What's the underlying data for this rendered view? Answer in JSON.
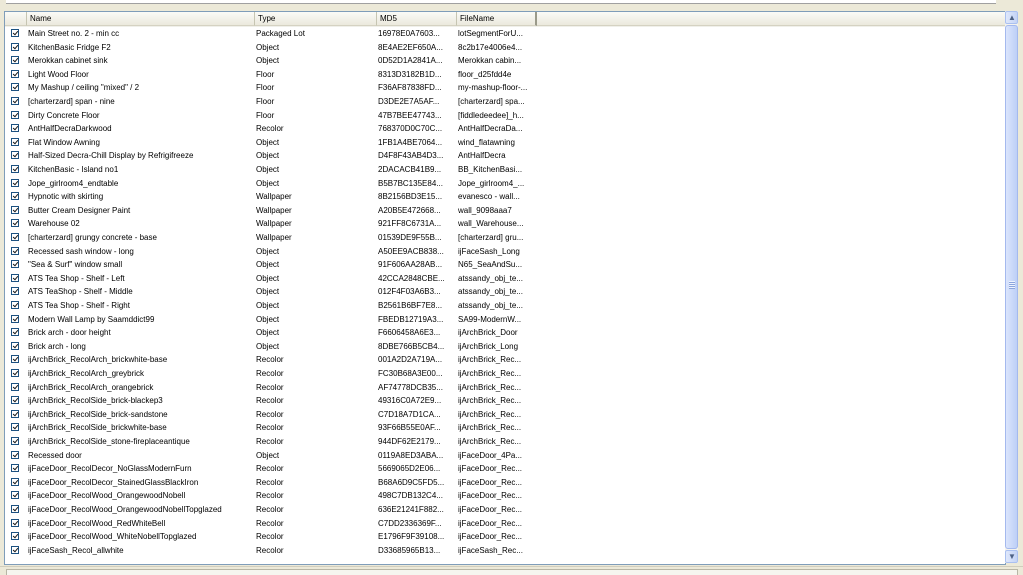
{
  "columns": {
    "name": "Name",
    "type": "Type",
    "md5": "MD5",
    "filename": "FileName"
  },
  "rows": [
    {
      "name": "Main Street no. 2 - min cc",
      "type": "Packaged Lot",
      "md5": "16978E0A7603...",
      "file": "lotSegmentForU..."
    },
    {
      "name": "KitchenBasic Fridge F2",
      "type": "Object",
      "md5": "8E4AE2EF650A...",
      "file": "8c2b17e4006e4..."
    },
    {
      "name": "Merokkan cabinet sink",
      "type": "Object",
      "md5": "0D52D1A2841A...",
      "file": "Merokkan cabin..."
    },
    {
      "name": "Light Wood Floor",
      "type": "Floor",
      "md5": "8313D3182B1D...",
      "file": "floor_d25fdd4e"
    },
    {
      "name": "My Mashup / ceiling \"mixed\" / 2",
      "type": "Floor",
      "md5": "F36AF87838FD...",
      "file": "my-mashup-floor-..."
    },
    {
      "name": "[charterzard] span - nine",
      "type": "Floor",
      "md5": "D3DE2E7A5AF...",
      "file": "[charterzard] spa..."
    },
    {
      "name": "Dirty Concrete Floor",
      "type": "Floor",
      "md5": "47B7BEE47743...",
      "file": "[fiddledeedee]_h..."
    },
    {
      "name": "AntHalfDecraDarkwood",
      "type": "Recolor",
      "md5": "768370D0C70C...",
      "file": "AntHalfDecraDa..."
    },
    {
      "name": "Flat Window Awning",
      "type": "Object",
      "md5": "1FB1A4BE7064...",
      "file": "wind_flatawning"
    },
    {
      "name": "Half-Sized Decra-Chill Display by Refrigifreeze",
      "type": "Object",
      "md5": "D4F8F43AB4D3...",
      "file": "AntHalfDecra"
    },
    {
      "name": "KitchenBasic - Island no1",
      "type": "Object",
      "md5": "2DACACB41B9...",
      "file": "BB_KitchenBasi..."
    },
    {
      "name": "Jope_girlroom4_endtable",
      "type": "Object",
      "md5": "B5B7BC135E84...",
      "file": "Jope_girlroom4_..."
    },
    {
      "name": "Hypnotic with skirting",
      "type": "Wallpaper",
      "md5": "8B2156BD3E15...",
      "file": "evanesco - wall..."
    },
    {
      "name": "Butter Cream Designer Paint",
      "type": "Wallpaper",
      "md5": "A20B5E472668...",
      "file": "wall_9098aaa7"
    },
    {
      "name": "Warehouse 02",
      "type": "Wallpaper",
      "md5": "921FF8C6731A...",
      "file": "wall_Warehouse..."
    },
    {
      "name": "[charterzard] grungy concrete - base",
      "type": "Wallpaper",
      "md5": "01539DE9F55B...",
      "file": "[charterzard] gru..."
    },
    {
      "name": "Recessed sash window - long",
      "type": "Object",
      "md5": "A50EE9ACB838...",
      "file": "ijFaceSash_Long"
    },
    {
      "name": "\"Sea & Surf\" window small",
      "type": "Object",
      "md5": "91F606AA28AB...",
      "file": "N65_SeaAndSu..."
    },
    {
      "name": "ATS Tea Shop - Shelf - Left",
      "type": "Object",
      "md5": "42CCA2848CBE...",
      "file": "atssandy_obj_te..."
    },
    {
      "name": "ATS TeaShop - Shelf - Middle",
      "type": "Object",
      "md5": "012F4F03A6B3...",
      "file": "atssandy_obj_te..."
    },
    {
      "name": "ATS Tea Shop - Shelf - Right",
      "type": "Object",
      "md5": "B2561B6BF7E8...",
      "file": "atssandy_obj_te..."
    },
    {
      "name": "Modern Wall Lamp by Saamddict99",
      "type": "Object",
      "md5": "FBEDB12719A3...",
      "file": "SA99-ModernW..."
    },
    {
      "name": "Brick arch - door height",
      "type": "Object",
      "md5": "F6606458A6E3...",
      "file": "ijArchBrick_Door"
    },
    {
      "name": "Brick arch - long",
      "type": "Object",
      "md5": "8DBE766B5CB4...",
      "file": "ijArchBrick_Long"
    },
    {
      "name": "ijArchBrick_RecolArch_brickwhite-base",
      "type": "Recolor",
      "md5": "001A2D2A719A...",
      "file": "ijArchBrick_Rec..."
    },
    {
      "name": "ijArchBrick_RecolArch_greybrick",
      "type": "Recolor",
      "md5": "FC30B68A3E00...",
      "file": "ijArchBrick_Rec..."
    },
    {
      "name": "ijArchBrick_RecolArch_orangebrick",
      "type": "Recolor",
      "md5": "AF74778DCB35...",
      "file": "ijArchBrick_Rec..."
    },
    {
      "name": "ijArchBrick_RecolSide_brick-blackep3",
      "type": "Recolor",
      "md5": "49316C0A72E9...",
      "file": "ijArchBrick_Rec..."
    },
    {
      "name": "ijArchBrick_RecolSide_brick-sandstone",
      "type": "Recolor",
      "md5": "C7D18A7D1CA...",
      "file": "ijArchBrick_Rec..."
    },
    {
      "name": "ijArchBrick_RecolSide_brickwhite-base",
      "type": "Recolor",
      "md5": "93F66B55E0AF...",
      "file": "ijArchBrick_Rec..."
    },
    {
      "name": "ijArchBrick_RecolSide_stone-fireplaceantique",
      "type": "Recolor",
      "md5": "944DF62E2179...",
      "file": "ijArchBrick_Rec..."
    },
    {
      "name": "Recessed door",
      "type": "Object",
      "md5": "0119A8ED3ABA...",
      "file": "ijFaceDoor_4Pa..."
    },
    {
      "name": "ijFaceDoor_RecolDecor_NoGlassModernFurn",
      "type": "Recolor",
      "md5": "5669065D2E06...",
      "file": "ijFaceDoor_Rec..."
    },
    {
      "name": "ijFaceDoor_RecolDecor_StainedGlassBlackIron",
      "type": "Recolor",
      "md5": "B68A6D9C5FD5...",
      "file": "ijFaceDoor_Rec..."
    },
    {
      "name": "ijFaceDoor_RecolWood_OrangewoodNobell",
      "type": "Recolor",
      "md5": "498C7DB132C4...",
      "file": "ijFaceDoor_Rec..."
    },
    {
      "name": "ijFaceDoor_RecolWood_OrangewoodNobellTopglazed",
      "type": "Recolor",
      "md5": "636E21241F882...",
      "file": "ijFaceDoor_Rec..."
    },
    {
      "name": "ijFaceDoor_RecolWood_RedWhiteBell",
      "type": "Recolor",
      "md5": "C7DD2336369F...",
      "file": "ijFaceDoor_Rec..."
    },
    {
      "name": "ijFaceDoor_RecolWood_WhiteNobellTopglazed",
      "type": "Recolor",
      "md5": "E1796F9F39108...",
      "file": "ijFaceDoor_Rec..."
    },
    {
      "name": "ijFaceSash_Recol_allwhite",
      "type": "Recolor",
      "md5": "D33685965B13...",
      "file": "ijFaceSash_Rec..."
    }
  ],
  "scrollbar": {
    "up_icon": "scroll-up-arrow",
    "down_icon": "scroll-down-arrow"
  }
}
